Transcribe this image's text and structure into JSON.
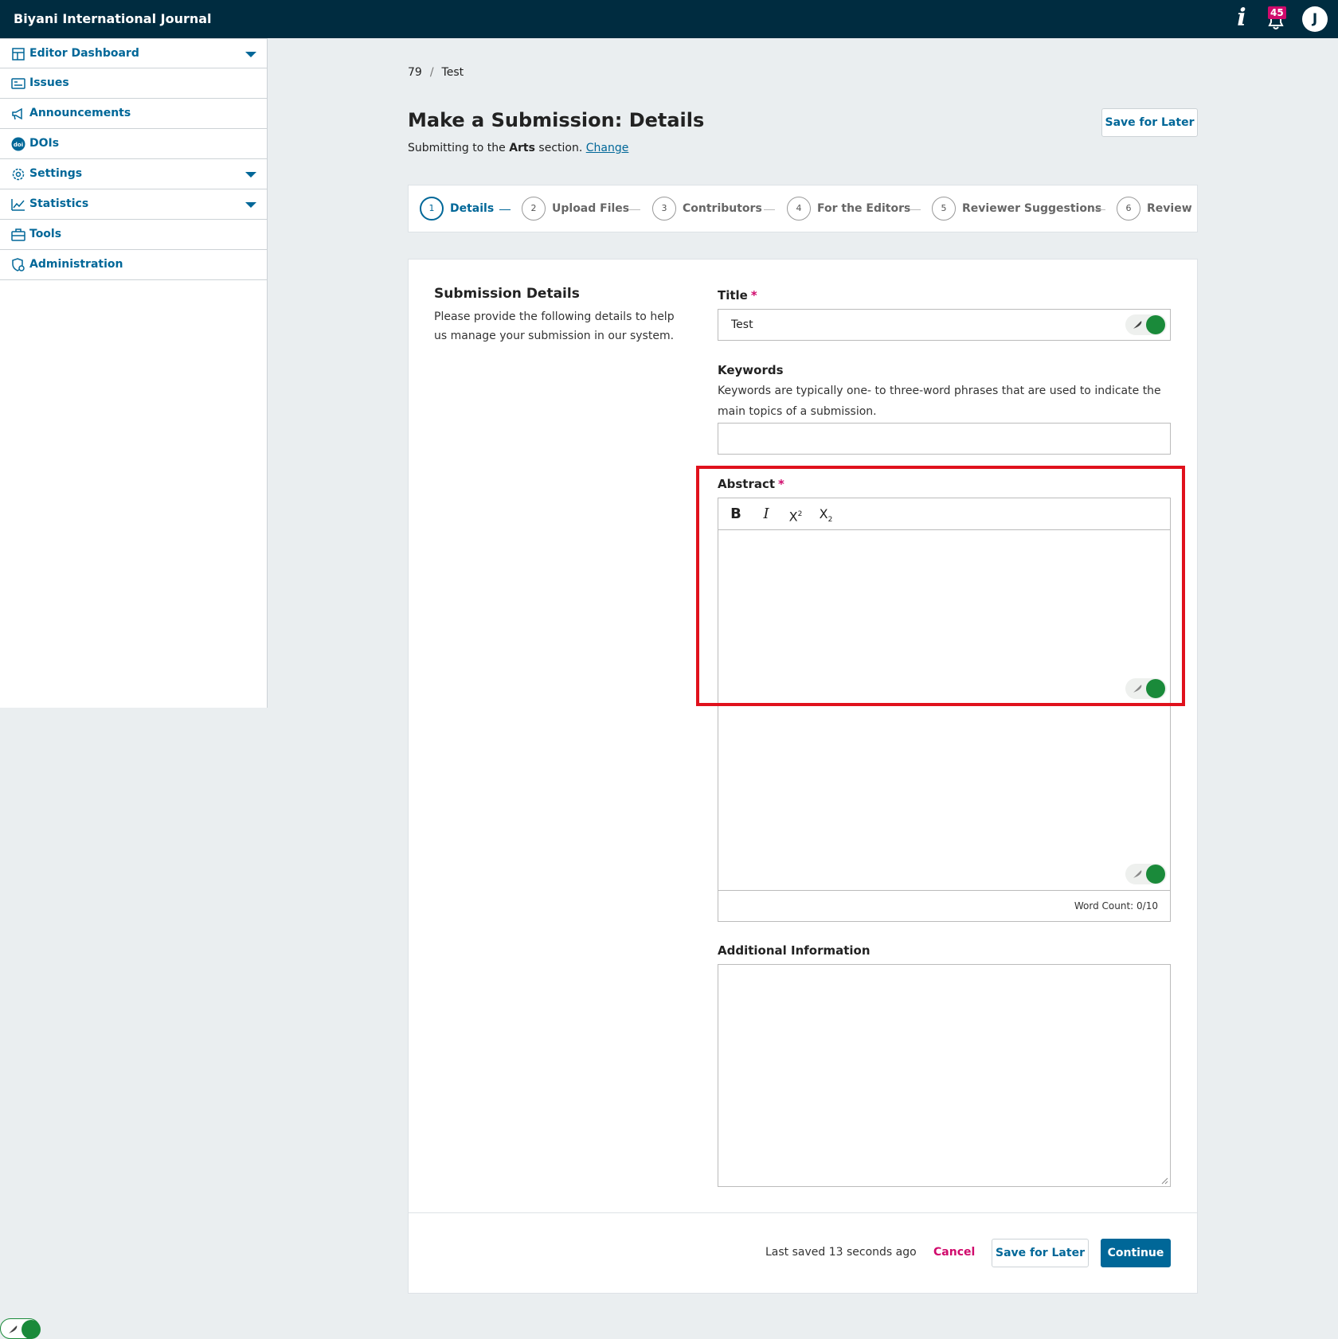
{
  "header": {
    "title": "Biyani International Journal",
    "notification_count": "45",
    "avatar_initial": "J"
  },
  "sidebar": {
    "items": [
      {
        "label": "Editor Dashboard",
        "icon": "dashboard-icon",
        "has_caret": true
      },
      {
        "label": "Issues",
        "icon": "issues-icon",
        "has_caret": false
      },
      {
        "label": "Announcements",
        "icon": "megaphone-icon",
        "has_caret": false
      },
      {
        "label": "DOIs",
        "icon": "doi-icon",
        "has_caret": false
      },
      {
        "label": "Settings",
        "icon": "gear-icon",
        "has_caret": true
      },
      {
        "label": "Statistics",
        "icon": "chart-icon",
        "has_caret": true
      },
      {
        "label": "Tools",
        "icon": "toolbox-icon",
        "has_caret": false
      },
      {
        "label": "Administration",
        "icon": "admin-icon",
        "has_caret": false
      }
    ]
  },
  "breadcrumb": {
    "id": "79",
    "separator": "/",
    "title": "Test"
  },
  "page": {
    "title": "Make a Submission: Details",
    "sub_prefix": "Submitting to the",
    "section": "Arts",
    "sub_suffix": "section.",
    "change_link": "Change",
    "save_later": "Save for Later"
  },
  "steps": [
    {
      "num": "1",
      "label": "Details"
    },
    {
      "num": "2",
      "label": "Upload Files"
    },
    {
      "num": "3",
      "label": "Contributors"
    },
    {
      "num": "4",
      "label": "For the Editors"
    },
    {
      "num": "5",
      "label": "Reviewer Suggestions"
    },
    {
      "num": "6",
      "label": "Review"
    }
  ],
  "form": {
    "section_title": "Submission Details",
    "section_desc": "Please provide the following details to help us manage your submission in our system.",
    "title_label": "Title",
    "title_value": "Test",
    "required_mark": "*",
    "keywords_label": "Keywords",
    "keywords_desc": "Keywords are typically one- to three-word phrases that are used to indicate the main topics of a submission.",
    "abstract_label": "Abstract",
    "word_count": "Word Count: 0/10",
    "additional_label": "Additional Information"
  },
  "footer": {
    "last_saved": "Last saved 13 seconds ago",
    "cancel": "Cancel",
    "save_later": "Save for Later",
    "continue": "Continue"
  },
  "colors": {
    "topbar": "#002c40",
    "link": "#006798",
    "required": "#d00a6c",
    "highlight": "#e0111c",
    "grammar_bot": "#1a8a3a"
  }
}
